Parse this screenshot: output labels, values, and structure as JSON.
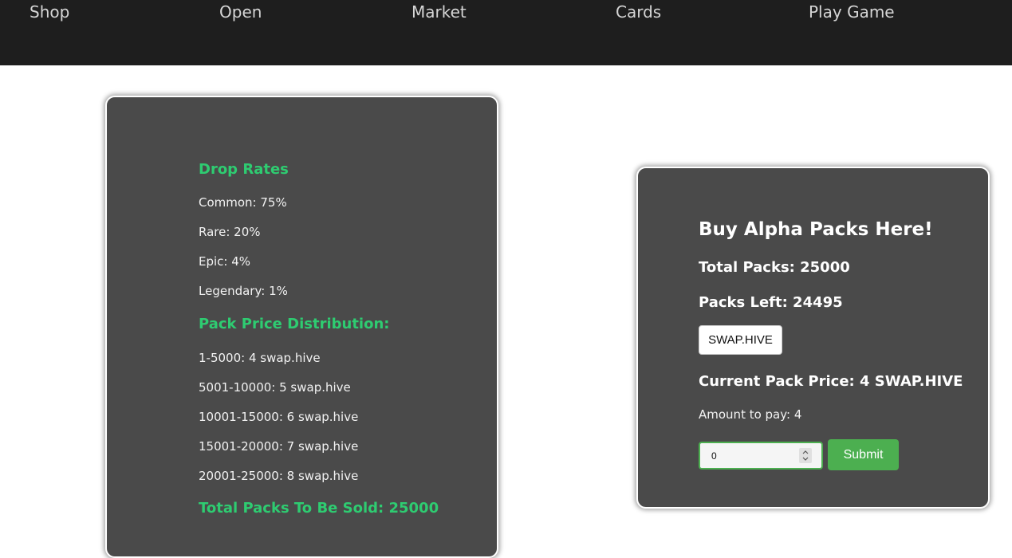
{
  "nav": {
    "shop": "Shop",
    "open": "Open",
    "market": "Market",
    "cards": "Cards",
    "play_game": "Play Game"
  },
  "info_panel": {
    "drop_rates_heading": "Drop Rates",
    "drop_rates": [
      "Common: 75%",
      "Rare: 20%",
      "Epic: 4%",
      "Legendary: 1%"
    ],
    "price_heading": "Pack Price Distribution:",
    "price_tiers": [
      "1-5000: 4 swap.hive",
      "5001-10000: 5 swap.hive",
      "10001-15000: 6 swap.hive",
      "15001-20000: 7 swap.hive",
      "20001-25000: 8 swap.hive"
    ],
    "total_sold": "Total Packs To Be Sold: 25000"
  },
  "buy_panel": {
    "title": "Buy Alpha Packs Here!",
    "total_packs": "Total Packs: 25000",
    "packs_left": "Packs Left: 24495",
    "currency_button": "SWAP.HIVE",
    "current_price": "Current Pack Price: 4 SWAP.HIVE",
    "amount_to_pay": "Amount to pay: 4",
    "quantity_value": "0",
    "submit_label": "Submit"
  },
  "colors": {
    "navbar_bg": "#1e1e1e",
    "panel_bg": "#4a4a4a",
    "accent_green": "#2ecc71",
    "button_green": "#4caf50"
  },
  "icons": {
    "spinner": "number-spinner-icon"
  }
}
